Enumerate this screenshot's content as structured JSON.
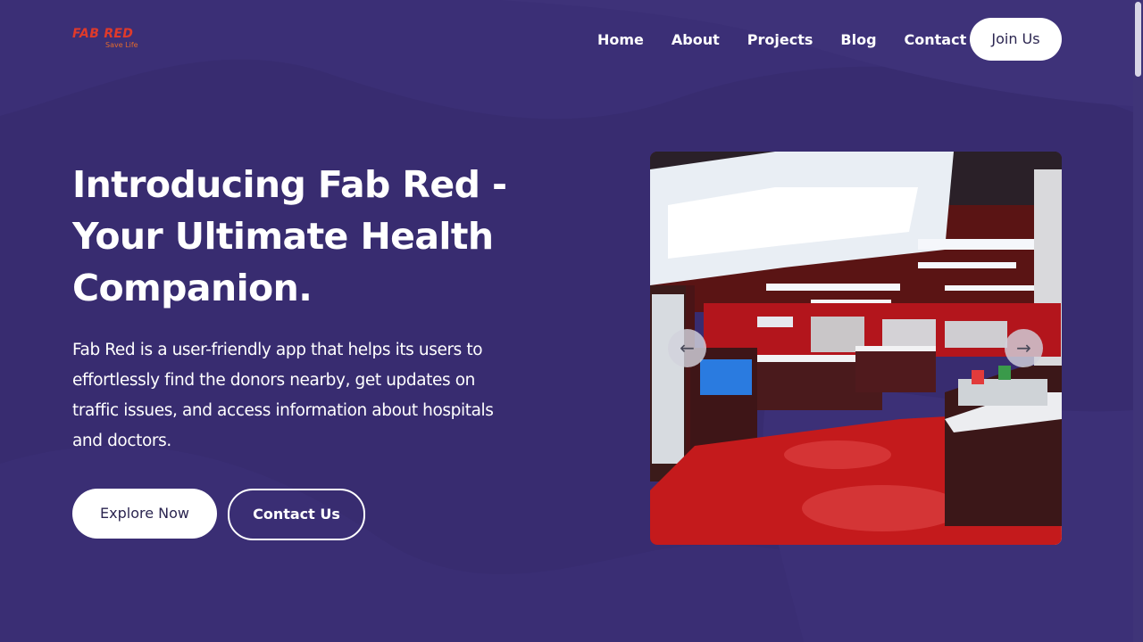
{
  "brand": {
    "name": "FAB RED",
    "tagline": "Save Life",
    "logo_color": "#e03a2a"
  },
  "nav": {
    "items": [
      {
        "label": "Home"
      },
      {
        "label": "About"
      },
      {
        "label": "Projects"
      },
      {
        "label": "Blog"
      },
      {
        "label": "Contact"
      }
    ],
    "cta_label": "Join Us"
  },
  "hero": {
    "title": "Introducing Fab Red - Your Ultimate Health Companion.",
    "description": "Fab Red is a user-friendly app that helps its users to effortlessly find the donors nearby, get updates on traffic issues, and access information about hospitals and doctors.",
    "primary_button": "Explore Now",
    "secondary_button": "Contact Us"
  },
  "carousel": {
    "prev_icon": "arrow-left-icon",
    "next_icon": "arrow-right-icon",
    "slide_description": "pharmacy-interior-photo"
  },
  "colors": {
    "background": "#382c70",
    "button_text": "#2b2550",
    "accent_red": "#c8141a"
  }
}
